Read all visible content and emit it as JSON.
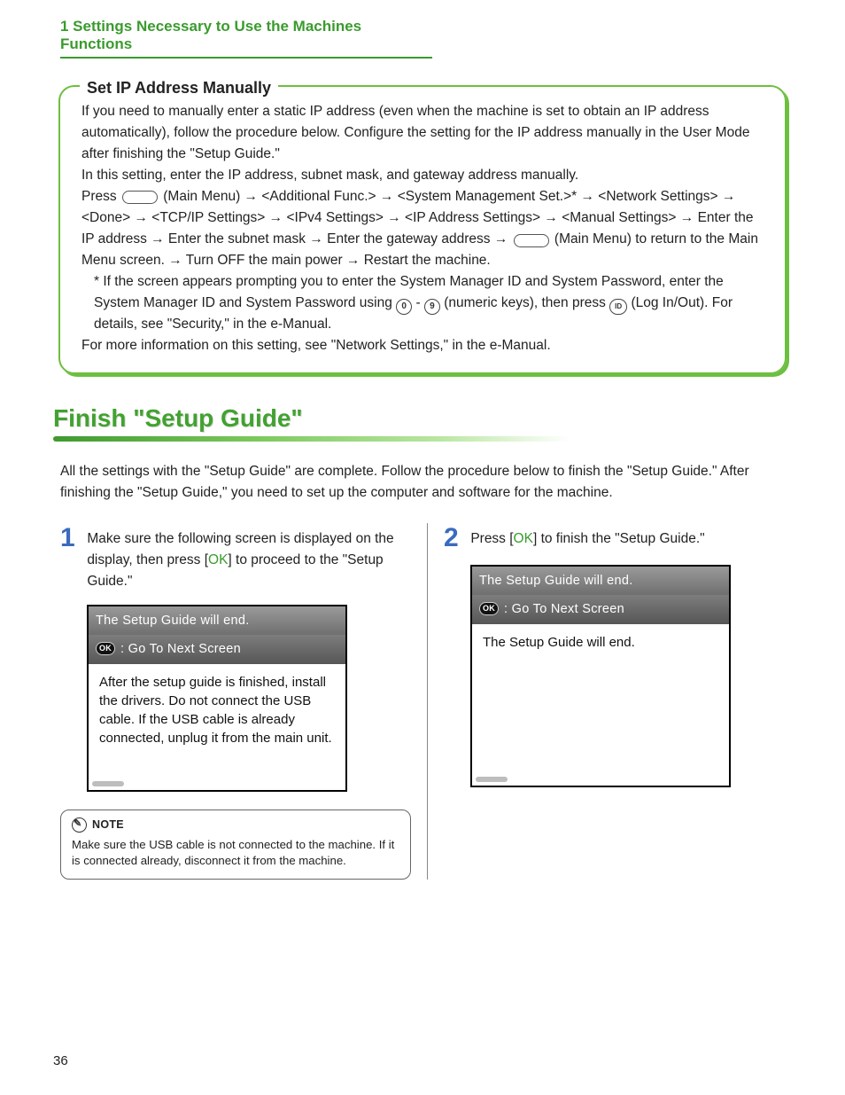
{
  "chapter_heading": "1 Settings Necessary to Use the Machines Functions",
  "callout": {
    "title": "Set IP Address Manually",
    "p1": "If you need to manually enter a static IP address (even when the machine is set to obtain an IP address automatically), follow the procedure below. Configure the setting for the IP address manually in the User Mode after finishing the \"Setup Guide.\"",
    "p2": "In this setting, enter the IP address, subnet mask, and gateway address manually.",
    "press_label": "Press ",
    "main_menu_1": " (Main Menu) → <Additional Func.> → <System Management Set.>* → <Network Settings> → <Done> → <TCP/IP Settings> → <IPv4 Settings> → <IP Address Settings> → <Manual Settings> → Enter the IP address → Enter the subnet mask → Enter the gateway address → ",
    "main_menu_2": " (Main Menu) to return to the Main Menu screen. → Turn OFF the main power → Restart the machine.",
    "footnote_pre": "* If the screen appears prompting you to enter the System Manager ID and System Password, enter the System Manager ID and System Password using ",
    "key0": "0",
    "key9": "9",
    "numeric_keys_label": " (numeric keys), then press ",
    "keyID": "ID",
    "login_label": " (Log In/Out). For details, see \"Security,\" in the e-Manual.",
    "more_info": "For more information on this setting, see \"Network Settings,\" in the e-Manual."
  },
  "section_title": "Finish \"Setup Guide\"",
  "intro": "All the settings with the \"Setup Guide\" are complete. Follow the procedure below to finish the \"Setup Guide.\" After finishing the \"Setup Guide,\" you need to set up the computer and software for the machine.",
  "steps": {
    "s1": {
      "num": "1",
      "pre": "Make sure the following screen is displayed on the display, then press [",
      "ok": "OK",
      "post": "] to proceed to the \"Setup Guide.\"",
      "lcd_title": "The Setup Guide will end.",
      "lcd_sub": ": Go To Next Screen",
      "lcd_ok": "OK",
      "lcd_body": "After the setup guide is finished, install the drivers. Do not connect the USB cable. If the USB cable is already connected, unplug it from the main unit."
    },
    "s2": {
      "num": "2",
      "pre": "Press [",
      "ok": "OK",
      "post": "] to finish the \"Setup Guide.\"",
      "lcd_title": "The Setup Guide will end.",
      "lcd_sub": ": Go To Next Screen",
      "lcd_ok": "OK",
      "lcd_body": "The Setup Guide will end."
    }
  },
  "note": {
    "label": "NOTE",
    "body": "Make sure the USB cable is not connected to the machine. If it is connected already, disconnect it from the machine."
  },
  "page_number": "36"
}
